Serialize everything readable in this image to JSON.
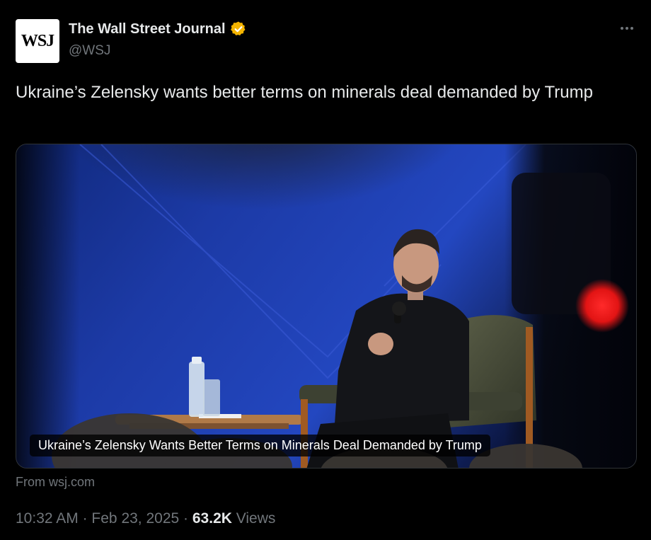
{
  "author": {
    "avatar_text": "WSJ",
    "display_name": "The Wall Street Journal",
    "handle": "@WSJ",
    "verified_icon": "gold-verified-badge-icon",
    "verified_color": "#f4b400"
  },
  "more_icon": "more-horizontal-icon",
  "tweet": {
    "text": "Ukraine’s Zelensky wants better terms on minerals deal demanded by Trump"
  },
  "card": {
    "image_description": "Zelensky seated in armchair holding microphone on blue-lit stage",
    "caption": "Ukraine’s Zelensky Wants Better Terms on Minerals Deal Demanded by Trump",
    "source": "From wsj.com"
  },
  "meta": {
    "time": "10:32 AM",
    "separator": "·",
    "date": "Feb 23, 2025",
    "views_count": "63.2K",
    "views_label": "Views"
  },
  "colors": {
    "background": "#000000",
    "primary_text": "#e7e9ea",
    "secondary_text": "#71767b",
    "border": "#2f3336"
  }
}
